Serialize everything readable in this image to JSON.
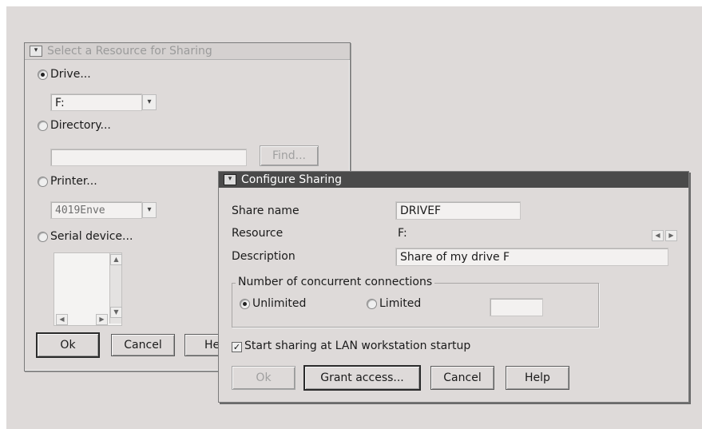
{
  "window1": {
    "title": "Select a Resource for Sharing",
    "drive": {
      "label": "Drive...",
      "mnemonic": "D",
      "selected": true,
      "value": "F:"
    },
    "directory": {
      "label": "Directory...",
      "mnemonic": "D",
      "selected": false,
      "value": "",
      "find_label": "Find..."
    },
    "printer": {
      "label": "Printer...",
      "mnemonic": "P",
      "selected": false,
      "value": "4019Enve"
    },
    "serial": {
      "label": "Serial device...",
      "mnemonic": "S",
      "selected": false
    },
    "buttons": {
      "ok": "Ok",
      "cancel": "Cancel",
      "help": "He"
    }
  },
  "window2": {
    "title": "Configure Sharing",
    "share_name_label": "Share name",
    "share_name_value": "DRIVEF",
    "resource_label": "Resource",
    "resource_value": "F:",
    "description_label": "Description",
    "description_value": "Share of my drive F",
    "connections_group_label": "Number of concurrent connections",
    "unlimited_label": "Unlimited",
    "unlimited_selected": true,
    "limited_label": "Limited",
    "limited_value": "",
    "start_sharing_label": "Start sharing at LAN workstation startup",
    "start_sharing_checked": true,
    "buttons": {
      "ok": "Ok",
      "grant": "Grant access...",
      "cancel": "Cancel",
      "help": "Help"
    }
  }
}
